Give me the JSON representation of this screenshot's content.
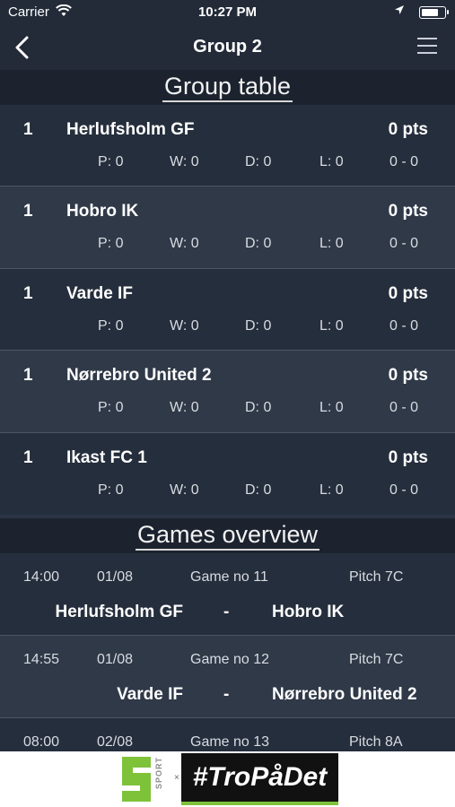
{
  "status": {
    "carrier": "Carrier",
    "time": "10:27 PM"
  },
  "nav": {
    "title": "Group 2"
  },
  "group_table": {
    "heading": "Group table",
    "teams": [
      {
        "rank": "1",
        "name": "Herlufsholm GF",
        "pts": "0 pts",
        "p": "P: 0",
        "w": "W: 0",
        "d": "D: 0",
        "l": "L: 0",
        "goals": "0 - 0"
      },
      {
        "rank": "1",
        "name": "Hobro IK",
        "pts": "0 pts",
        "p": "P: 0",
        "w": "W: 0",
        "d": "D: 0",
        "l": "L: 0",
        "goals": "0 - 0"
      },
      {
        "rank": "1",
        "name": "Varde IF",
        "pts": "0 pts",
        "p": "P: 0",
        "w": "W: 0",
        "d": "D: 0",
        "l": "L: 0",
        "goals": "0 - 0"
      },
      {
        "rank": "1",
        "name": "Nørrebro United 2",
        "pts": "0 pts",
        "p": "P: 0",
        "w": "W: 0",
        "d": "D: 0",
        "l": "L: 0",
        "goals": "0 - 0"
      },
      {
        "rank": "1",
        "name": "Ikast FC 1",
        "pts": "0 pts",
        "p": "P: 0",
        "w": "W: 0",
        "d": "D: 0",
        "l": "L: 0",
        "goals": "0 - 0"
      }
    ]
  },
  "games": {
    "heading": "Games overview",
    "items": [
      {
        "time": "14:00",
        "date": "01/08",
        "game_no": "Game no 11",
        "pitch": "Pitch 7C",
        "home": "Herlufsholm GF",
        "sep": "-",
        "away": "Hobro IK"
      },
      {
        "time": "14:55",
        "date": "01/08",
        "game_no": "Game no 12",
        "pitch": "Pitch 7C",
        "home": "Varde IF",
        "sep": "-",
        "away": "Nørrebro United 2"
      },
      {
        "time": "08:00",
        "date": "02/08",
        "game_no": "Game no 13",
        "pitch": "Pitch 8A",
        "home": "",
        "sep": "",
        "away": ""
      }
    ]
  },
  "ad": {
    "side_text": "SPORT",
    "x": "×",
    "hashtag": "#TroPåDet",
    "accent": "#7ec23a"
  }
}
